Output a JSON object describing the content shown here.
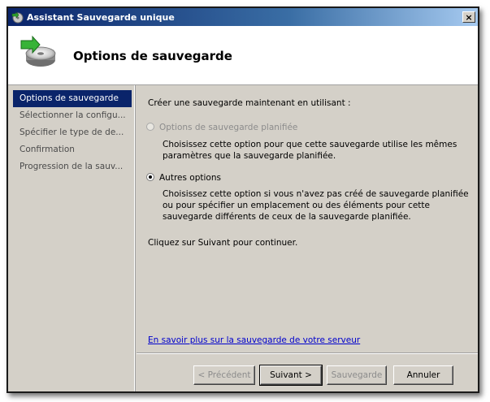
{
  "window": {
    "title": "Assistant Sauvegarde unique",
    "close_label": "×"
  },
  "header": {
    "title": "Options de sauvegarde",
    "icon": "backup-disk-icon"
  },
  "nav": {
    "items": [
      {
        "label": "Options de sauvegarde",
        "active": true
      },
      {
        "label": "Sélectionner la configu..."
      },
      {
        "label": "Spécifier le type de de..."
      },
      {
        "label": "Confirmation"
      },
      {
        "label": "Progression de la sauv..."
      }
    ]
  },
  "content": {
    "intro": "Créer une sauvegarde maintenant en utilisant :",
    "options": [
      {
        "label": "Options de sauvegarde planifiée",
        "description": "Choisissez cette option pour que cette sauvegarde utilise les mêmes paramètres que la sauvegarde planifiée.",
        "checked": false,
        "disabled": true
      },
      {
        "label": "Autres options",
        "description": "Choisissez cette option si vous n'avez pas créé de sauvegarde planifiée ou pour spécifier un emplacement ou des éléments pour cette sauvegarde différents de ceux de la sauvegarde planifiée.",
        "checked": true,
        "disabled": false
      }
    ],
    "continue_text": "Cliquez sur Suivant pour continuer.",
    "link": "En savoir plus sur la sauvegarde de votre serveur"
  },
  "buttons": {
    "previous": "< Précédent",
    "next": "Suivant >",
    "backup": "Sauvegarde",
    "cancel": "Annuler"
  }
}
